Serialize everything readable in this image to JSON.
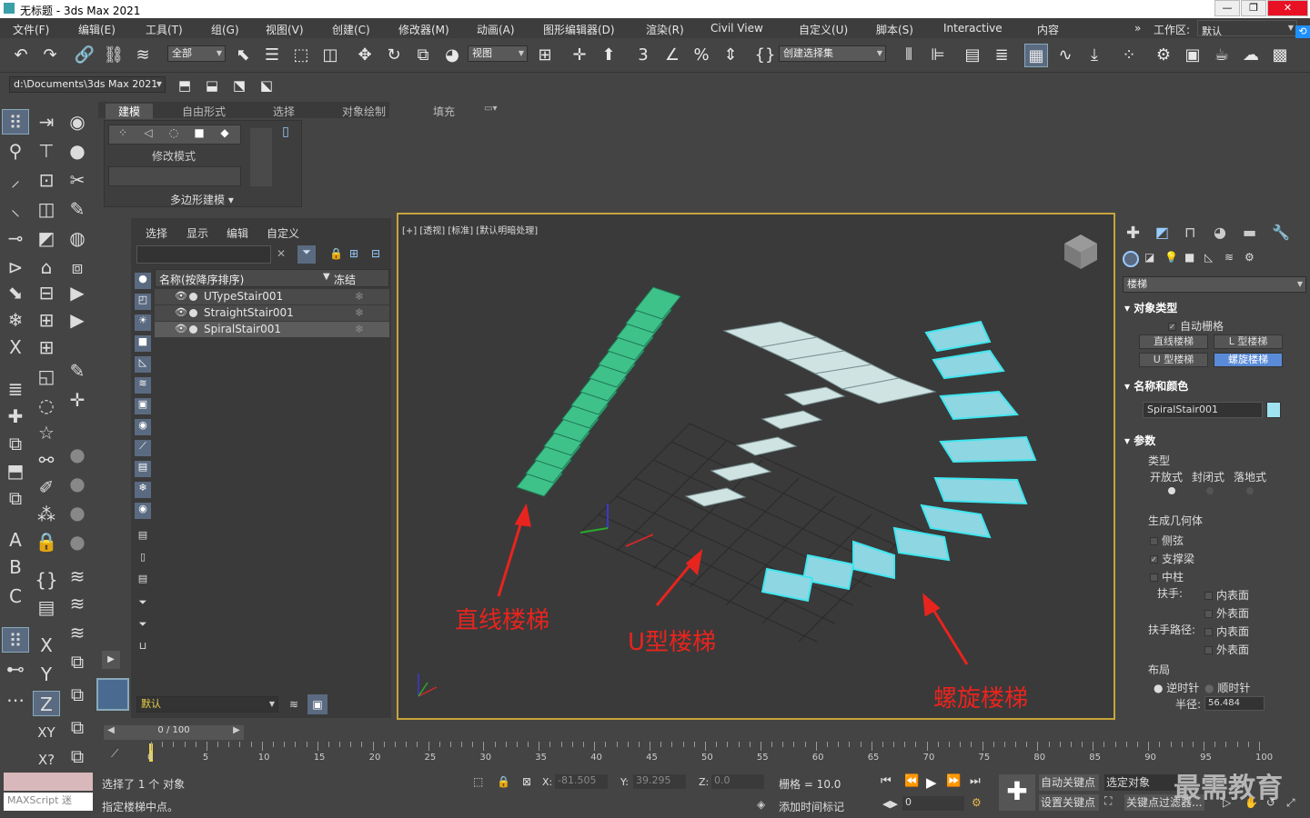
{
  "window": {
    "title": "无标题 - 3ds Max 2021"
  },
  "menu": [
    "文件(F)",
    "编辑(E)",
    "工具(T)",
    "组(G)",
    "视图(V)",
    "创建(C)",
    "修改器(M)",
    "动画(A)",
    "图形编辑器(D)",
    "渲染(R)",
    "Civil View",
    "自定义(U)",
    "脚本(S)",
    "Interactive",
    "内容"
  ],
  "workspace": {
    "label": "工作区:",
    "value": "默认"
  },
  "toolbar": {
    "selection_filter": "全部",
    "ref_coord": "视图",
    "named_selection": "创建选择集"
  },
  "project_path": "d:\\Documents\\3ds Max 2021",
  "ribbon": {
    "tabs": [
      "建模",
      "自由形式",
      "选择",
      "对象绘制",
      "填充"
    ],
    "edit_mode": "修改模式",
    "poly_modeling": "多边形建模"
  },
  "scene_explorer": {
    "menu": [
      "选择",
      "显示",
      "编辑",
      "自定义"
    ],
    "col_name": "名称(按降序排序)",
    "col_frozen": "冻结",
    "objects": [
      "UTypeStair001",
      "StraightStair001",
      "SpiralStair001"
    ],
    "layer": "默认"
  },
  "viewport": {
    "label": "[+] [透视] [标准] [默认明暗处理]",
    "annotations": [
      "直线楼梯",
      "U型楼梯",
      "螺旋楼梯"
    ]
  },
  "command_panel": {
    "category": "楼梯",
    "object_type": {
      "title": "对象类型",
      "autogrid": "自动栅格",
      "buttons": [
        "直线楼梯",
        "L 型楼梯",
        "U 型楼梯",
        "螺旋楼梯"
      ],
      "active": "螺旋楼梯"
    },
    "name_color": {
      "title": "名称和颜色",
      "name": "SpiralStair001",
      "color": "#9fe3ef"
    },
    "params": {
      "title": "参数",
      "type_label": "类型",
      "types": [
        "开放式",
        "封闭式",
        "落地式"
      ],
      "gen_geom": "生成几何体",
      "stringers": "侧弦",
      "carriage": "支撑梁",
      "center_pole": "中柱",
      "handrail": "扶手:",
      "rail_path": "扶手路径:",
      "inside": "内表面",
      "outside": "外表面",
      "layout": "布局",
      "ccw": "逆时针",
      "cw": "顺时针",
      "radius_label": "半径:",
      "radius": "56.484"
    }
  },
  "timeline": {
    "ticks": [
      "0",
      "5",
      "10",
      "15",
      "20",
      "25",
      "30",
      "35",
      "40",
      "45",
      "50",
      "55",
      "60",
      "65",
      "70",
      "75",
      "80",
      "85",
      "90",
      "95",
      "100"
    ],
    "frame": "0 / 100"
  },
  "status": {
    "selected": "选择了 1 个 对象",
    "prompt": "指定楼梯中点。",
    "maxscript": "MAXScript 迷",
    "x": "-81.505",
    "y": "39.295",
    "z": "0.0",
    "grid": "栅格 = 10.0",
    "add_time_tag": "添加时间标记",
    "auto_key": "自动关键点",
    "selected_obj": "选定对象",
    "set_key": "设置关键点",
    "key_filter": "关键点过滤器...",
    "frame_field": "0",
    "watermark": "最需教育"
  }
}
